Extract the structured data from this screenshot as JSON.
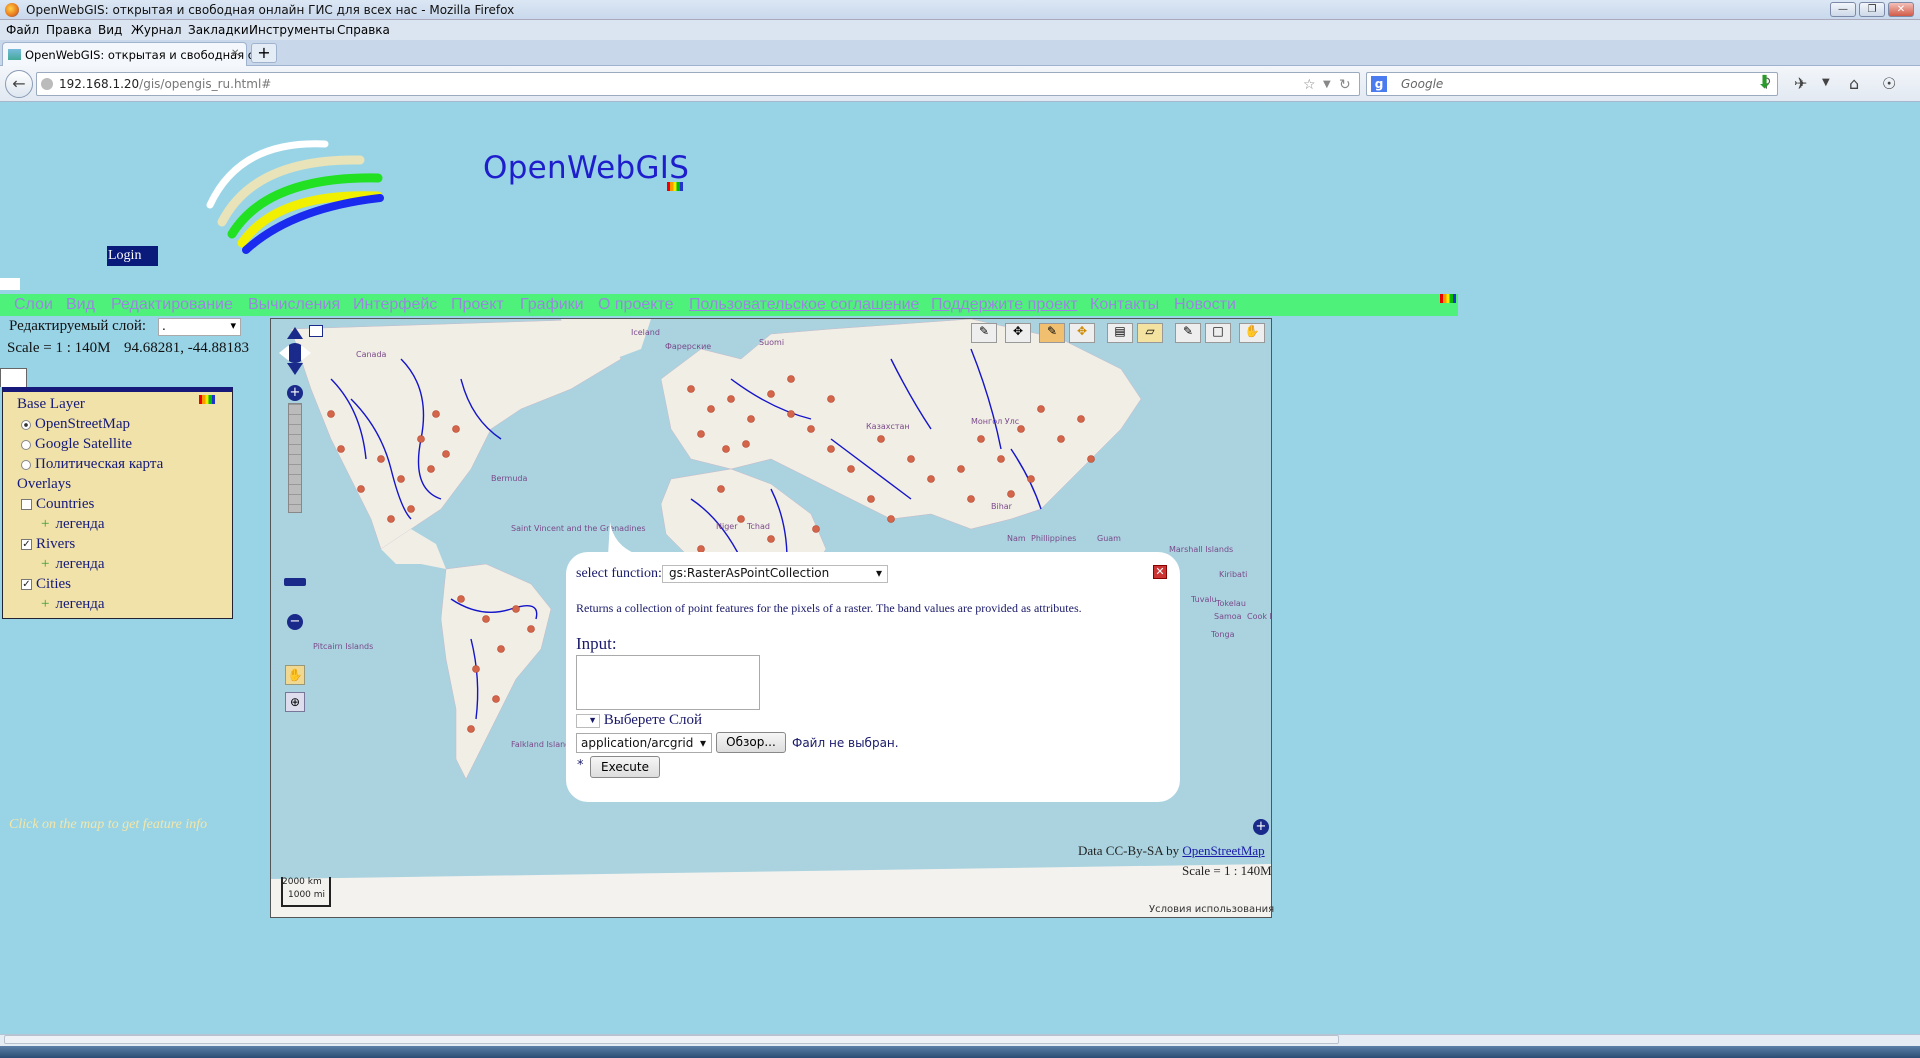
{
  "window": {
    "title": "OpenWebGIS: открытая и свободная онлайн ГИС для всех нас - Mozilla Firefox",
    "controls": [
      "—",
      "❐",
      "✕"
    ]
  },
  "menubar": [
    "Файл",
    "Правка",
    "Вид",
    "Журнал",
    "Закладки",
    "Инструменты",
    "Справка"
  ],
  "tab": {
    "label": "OpenWebGIS: открытая и свободная о...",
    "close": "✕",
    "new": "+"
  },
  "address": {
    "host": "192.168.1.20",
    "path": "/gis/opengis_ru.html#"
  },
  "search": {
    "engine": "g",
    "placeholder": "Google"
  },
  "header": {
    "brand": "OpenWebGIS",
    "login": "Login"
  },
  "menu": [
    "Слои",
    "Вид",
    "Редактирование",
    "Вычисления",
    "Интерфейс",
    "Проект",
    "Графики",
    "О проекте",
    "Пользовательское соглашение",
    "Поддержите проект",
    "Контакты",
    "Новости"
  ],
  "edit_layer": {
    "label": "Редактируемый слой:",
    "value": "."
  },
  "scale_text": "Scale = 1 : 140M",
  "coords": "94.68281, -44.88183",
  "layers": {
    "base_title": "Base Layer",
    "base": [
      {
        "label": "OpenStreetMap",
        "checked": true
      },
      {
        "label": "Google Satellite",
        "checked": false
      },
      {
        "label": "Политическая карта",
        "checked": false
      }
    ],
    "overlays_title": "Overlays",
    "overlays": [
      {
        "label": "Countries",
        "checked": false,
        "legend": "легенда"
      },
      {
        "label": "Rivers",
        "checked": true,
        "legend": "легенда"
      },
      {
        "label": "Cities",
        "checked": true,
        "legend": "легенда"
      }
    ]
  },
  "hint": "Click on the map to get feature info",
  "popup": {
    "select_label": "select function:",
    "function": "gs:RasterAsPointCollection",
    "description": "Returns a collection of point features for the pixels of a raster. The band values are provided as attributes.",
    "input_label": "Input:",
    "layer_pick": "Выберете Слой",
    "mime": "application/arcgrid",
    "browse": "Обзор...",
    "no_file": "Файл не выбран.",
    "required": "*",
    "execute": "Execute",
    "close": "✕"
  },
  "map": {
    "attribution_prefix": "Data CC-By-SA by",
    "attribution_link": "OpenStreetMap",
    "scale": "Scale = 1 : 140M",
    "terms": "Условия использования",
    "scalebar_km": "2000 km",
    "scalebar_mi": "1000 mi",
    "labels": [
      "Canada",
      "Bermuda",
      "Iceland",
      "Фарерские",
      "Suomi",
      "Казахстан",
      "Монгол Улс",
      "Phillippines",
      "Guam",
      "Marshall Islands",
      "Kiribati",
      "Tuvalu",
      "Samoa",
      "Tokelau",
      "Cook Islands",
      "Tonga",
      "Pitcairn Islands",
      "Falkland Islands (Malvinas)",
      "Saint Vincent and the Grenadines",
      "Tchad",
      "Niger",
      "Bihar",
      "Nam"
    ],
    "colors": {
      "land": "#f1eee6",
      "water": "#aad3df",
      "river": "#1414c8",
      "city": "#d2654a"
    }
  }
}
